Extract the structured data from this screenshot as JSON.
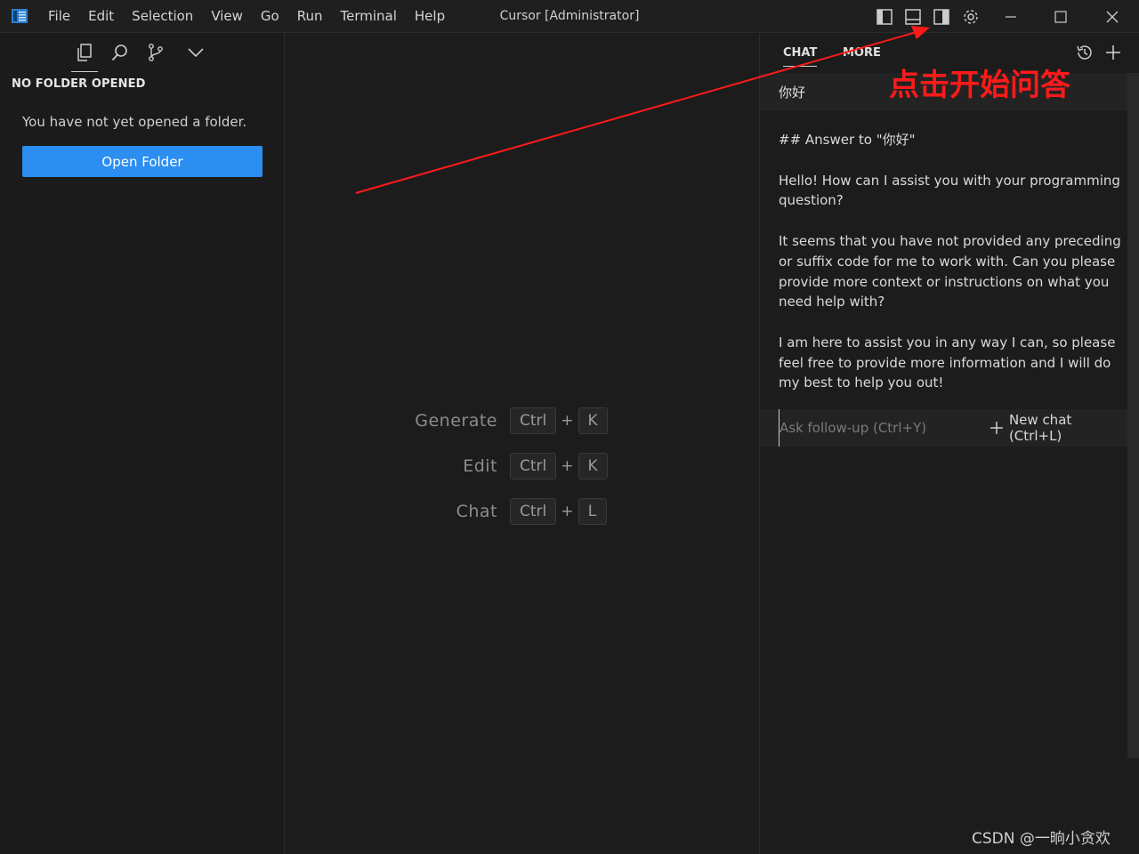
{
  "titlebar": {
    "menu": [
      "File",
      "Edit",
      "Selection",
      "View",
      "Go",
      "Run",
      "Terminal",
      "Help"
    ],
    "window_title": "Cursor [Administrator]",
    "layout_icons": [
      "toggle-primary-sidebar-icon",
      "toggle-panel-icon",
      "toggle-secondary-sidebar-icon",
      "settings-gear-icon"
    ],
    "window_controls": [
      "minimize-icon",
      "maximize-icon",
      "close-icon"
    ]
  },
  "sidebar": {
    "view_icons": [
      "explorer-icon",
      "search-icon",
      "source-control-icon",
      "chevron-down-icon"
    ],
    "title": "NO FOLDER OPENED",
    "message": "You have not yet opened a folder.",
    "open_folder_label": "Open Folder"
  },
  "editor": {
    "shortcuts": [
      {
        "label": "Generate",
        "keys": [
          "Ctrl",
          "K"
        ]
      },
      {
        "label": "Edit",
        "keys": [
          "Ctrl",
          "K"
        ]
      },
      {
        "label": "Chat",
        "keys": [
          "Ctrl",
          "L"
        ]
      }
    ],
    "plus": "+"
  },
  "chat": {
    "tabs": [
      "CHAT",
      "MORE"
    ],
    "active_tab": "CHAT",
    "actions": [
      "history-icon",
      "plus-icon"
    ],
    "user_message": "你好",
    "answer": {
      "heading": "## Answer to \"你好\"",
      "paragraphs": [
        "Hello! How can I assist you with your programming question?",
        "It seems that you have not provided any preceding or suffix code for me to work with. Can you please provide more context or instructions on what you need help with?",
        "I am here to assist you in any way I can, so please feel free to provide more information and I will do my best to help you out!"
      ]
    },
    "followup_placeholder": "Ask follow-up (Ctrl+Y)",
    "new_chat_label": "New chat (Ctrl+L)"
  },
  "annotation": {
    "text": "点击开始问答",
    "color": "#ff1a1a"
  },
  "watermark": "CSDN @一晌小贪欢",
  "colors": {
    "accent": "#2b8ef0",
    "background": "#1c1c1c"
  }
}
